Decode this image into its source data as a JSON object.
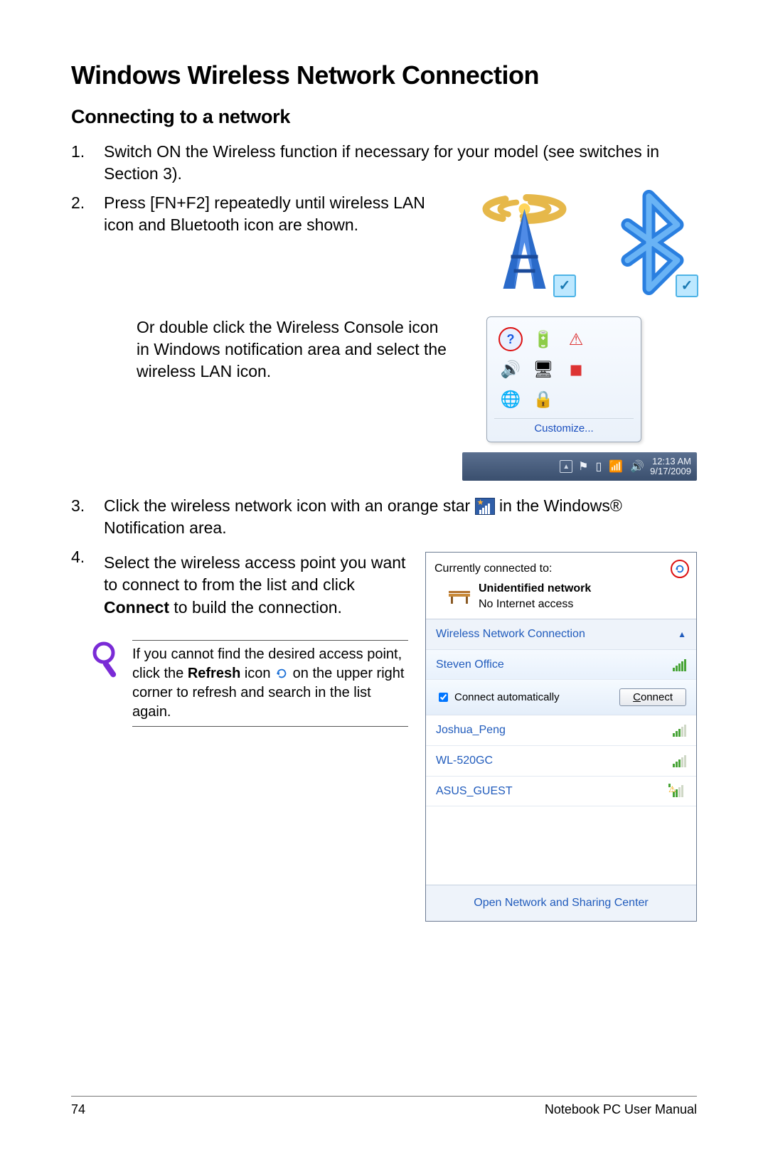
{
  "heading": "Windows Wireless Network Connection",
  "subheading": "Connecting to a network",
  "steps": {
    "s1": {
      "num": "1.",
      "text": "Switch ON the Wireless function if necessary for your model (see switches in Section 3)."
    },
    "s2": {
      "num": "2.",
      "text": "Press [FN+F2] repeatedly until wireless LAN icon and Bluetooth icon are shown."
    },
    "s2_or": "Or double click the Wireless Console icon in Windows notification area and select the wireless LAN icon.",
    "s3": {
      "num": "3.",
      "pre": "Click the wireless network icon with an orange star ",
      "post": " in the Windows® Notification area."
    },
    "s4": {
      "num": "4.",
      "pre": "Select the wireless access point you want to connect to from the list and click ",
      "bold": "Connect",
      "post": " to build the connection."
    }
  },
  "note": {
    "pre": "If you cannot find the desired access point, click the ",
    "bold": "Refresh",
    "mid": " icon ",
    "post": " on the upper right corner to refresh and search in the list again."
  },
  "tray": {
    "customize": "Customize...",
    "time": "12:13 AM",
    "date": "9/17/2009"
  },
  "wifi": {
    "head_label": "Currently connected to:",
    "net_name": "Unidentified network",
    "net_status": "No Internet access",
    "section": "Wireless Network Connection",
    "auto_label": "Connect automatically",
    "connect_btn": "Connect",
    "networks": [
      {
        "name": "Steven Office"
      },
      {
        "name": "Joshua_Peng"
      },
      {
        "name": "WL-520GC"
      },
      {
        "name": "ASUS_GUEST"
      }
    ],
    "open_center": "Open Network and Sharing Center"
  },
  "footer": {
    "page": "74",
    "book": "Notebook PC User Manual"
  }
}
